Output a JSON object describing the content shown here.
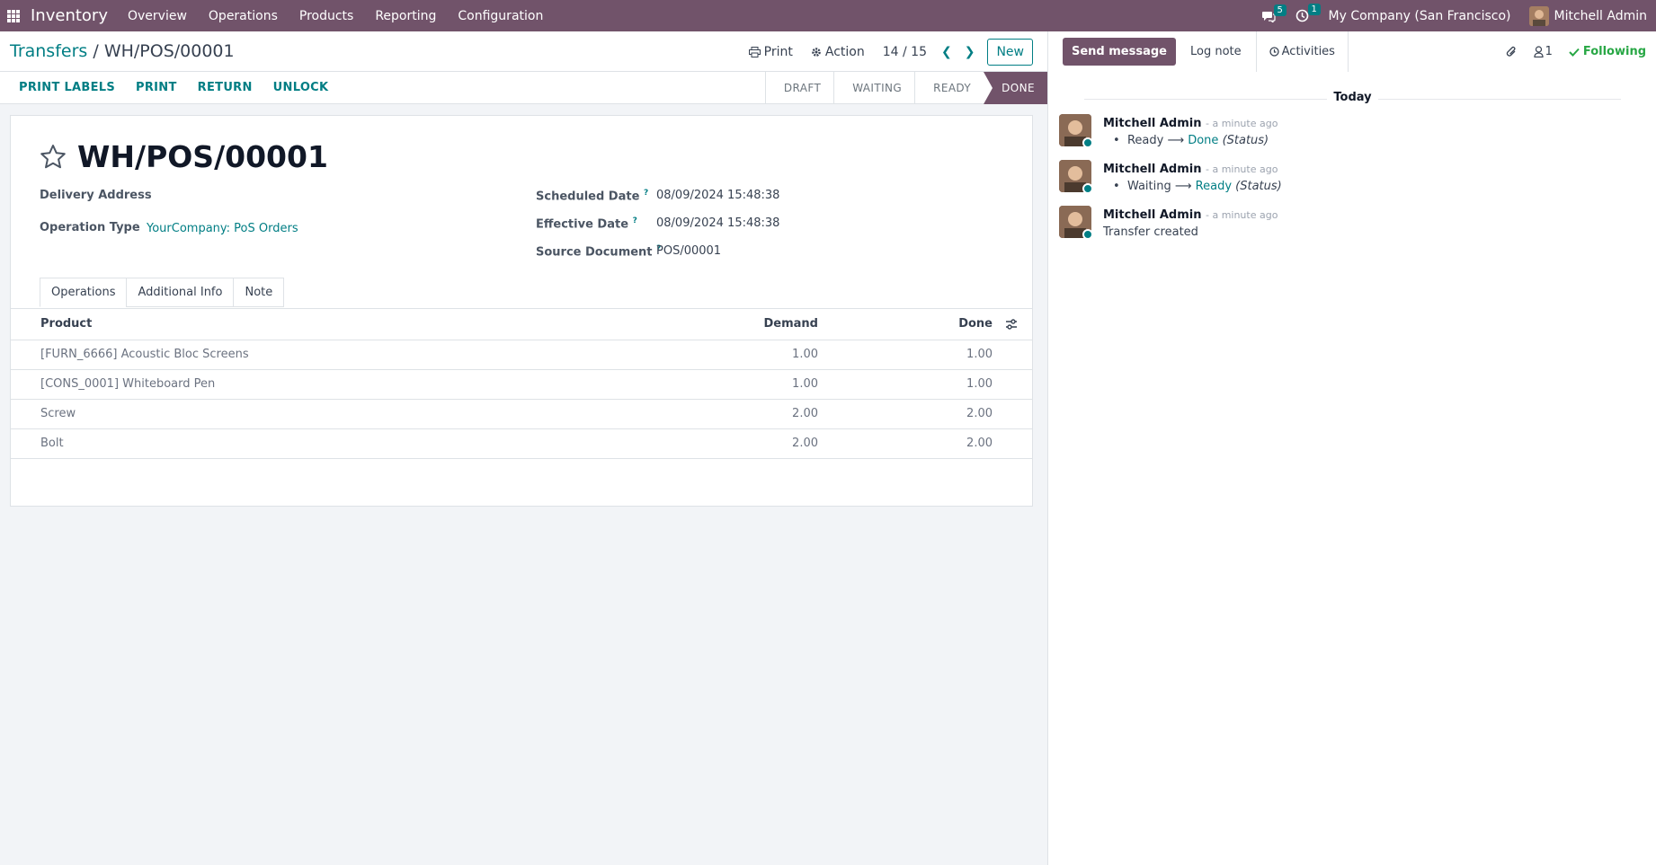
{
  "navbar": {
    "app_name": "Inventory",
    "menu": [
      "Overview",
      "Operations",
      "Products",
      "Reporting",
      "Configuration"
    ],
    "messages_badge": "5",
    "activities_badge": "1",
    "company": "My Company (San Francisco)",
    "user": "Mitchell Admin"
  },
  "breadcrumb": {
    "parent": "Transfers",
    "separator": "/",
    "current": "WH/POS/00001"
  },
  "control": {
    "print": "Print",
    "action": "Action",
    "pager": "14 / 15",
    "new": "New"
  },
  "actions": [
    "PRINT LABELS",
    "PRINT",
    "RETURN",
    "UNLOCK"
  ],
  "statusbar": [
    "DRAFT",
    "WAITING",
    "READY",
    "DONE"
  ],
  "active_status": "DONE",
  "record": {
    "name": "WH/POS/00001",
    "delivery_address_label": "Delivery Address",
    "operation_type_label": "Operation Type",
    "operation_type": "YourCompany: PoS Orders",
    "scheduled_date_label": "Scheduled Date",
    "scheduled_date": "08/09/2024 15:48:38",
    "effective_date_label": "Effective Date",
    "effective_date": "08/09/2024 15:48:38",
    "source_document_label": "Source Document",
    "source_document": "POS/00001",
    "help_mark": "?"
  },
  "tabs": [
    "Operations",
    "Additional Info",
    "Note"
  ],
  "table": {
    "headers": {
      "product": "Product",
      "demand": "Demand",
      "done": "Done"
    },
    "rows": [
      {
        "product": "[FURN_6666] Acoustic Bloc Screens",
        "demand": "1.00",
        "done": "1.00"
      },
      {
        "product": "[CONS_0001] Whiteboard Pen",
        "demand": "1.00",
        "done": "1.00"
      },
      {
        "product": "Screw",
        "demand": "2.00",
        "done": "2.00"
      },
      {
        "product": "Bolt",
        "demand": "2.00",
        "done": "2.00"
      }
    ]
  },
  "chatter": {
    "send_message": "Send message",
    "log_note": "Log note",
    "activities": "Activities",
    "followers_count": "1",
    "following": "Following",
    "date_separator": "Today",
    "messages": [
      {
        "author": "Mitchell Admin",
        "time": "- a minute ago",
        "old": "Ready",
        "new": "Done",
        "field": "(Status)"
      },
      {
        "author": "Mitchell Admin",
        "time": "- a minute ago",
        "old": "Waiting",
        "new": "Ready",
        "field": "(Status)"
      },
      {
        "author": "Mitchell Admin",
        "time": "- a minute ago",
        "text": "Transfer created"
      }
    ]
  },
  "colors": {
    "brand": "#71536a",
    "accent": "#017e84",
    "following": "#28a745"
  }
}
